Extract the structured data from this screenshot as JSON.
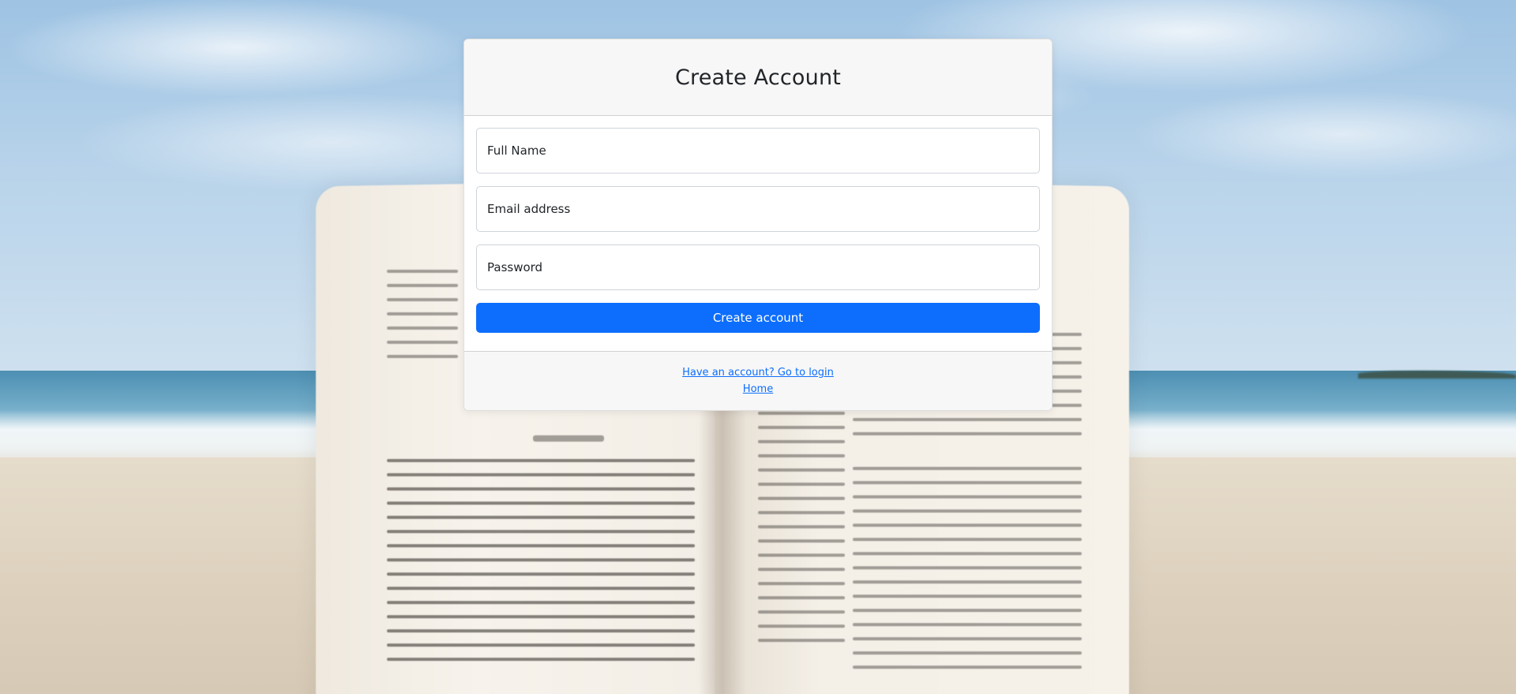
{
  "form": {
    "title": "Create Account",
    "fields": [
      {
        "name": "full-name",
        "placeholder": "Full Name",
        "value": ""
      },
      {
        "name": "email",
        "placeholder": "Email address",
        "value": ""
      },
      {
        "name": "password",
        "placeholder": "Password",
        "value": ""
      }
    ],
    "submit_label": "Create account"
  },
  "footer": {
    "login_link": "Have an account? Go to login",
    "home_link": "Home"
  },
  "colors": {
    "primary": "#0d6efd",
    "card_header_bg": "#f7f7f7",
    "text": "#212529"
  },
  "background": {
    "description_icon": "beach-book-photo"
  }
}
